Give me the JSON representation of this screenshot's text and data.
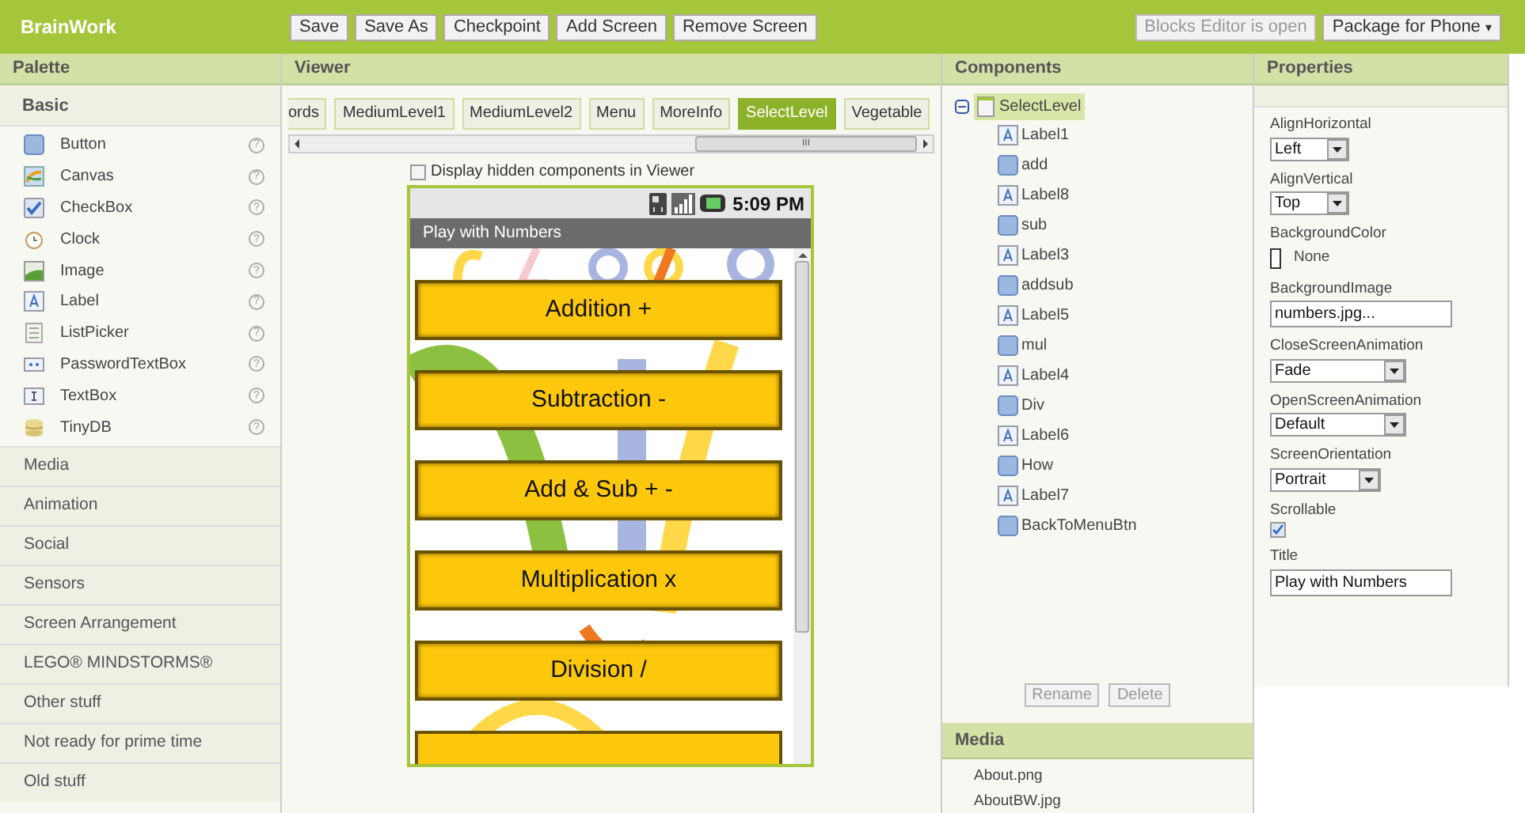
{
  "app": {
    "title": "BrainWork",
    "toolbar": [
      "Save",
      "Save As",
      "Checkpoint",
      "Add Screen",
      "Remove Screen"
    ],
    "blocks_button": {
      "label": "Blocks Editor is open",
      "disabled": true
    },
    "package_button": {
      "label": "Package for Phone",
      "caret": "▾"
    }
  },
  "palette": {
    "title": "Palette",
    "open_group": "Basic",
    "items": [
      {
        "label": "Button",
        "kind": "button",
        "help": "?"
      },
      {
        "label": "Canvas",
        "kind": "canvas",
        "help": "?"
      },
      {
        "label": "CheckBox",
        "kind": "checkbox",
        "help": "?"
      },
      {
        "label": "Clock",
        "kind": "clock",
        "help": "?"
      },
      {
        "label": "Image",
        "kind": "image",
        "help": "?"
      },
      {
        "label": "Label",
        "kind": "label",
        "help": "?"
      },
      {
        "label": "ListPicker",
        "kind": "list",
        "help": "?"
      },
      {
        "label": "PasswordTextBox",
        "kind": "password",
        "help": "?"
      },
      {
        "label": "TextBox",
        "kind": "textbox",
        "help": "?"
      },
      {
        "label": "TinyDB",
        "kind": "db",
        "help": "?"
      }
    ],
    "groups": [
      "Media",
      "Animation",
      "Social",
      "Sensors",
      "Screen Arrangement",
      "LEGO® MINDSTORMS®",
      "Other stuff",
      "Not ready for prime time",
      "Old stuff"
    ]
  },
  "viewer": {
    "title": "Viewer",
    "screens": [
      {
        "label": "ords",
        "selected": false
      },
      {
        "label": "MediumLevel1",
        "selected": false
      },
      {
        "label": "MediumLevel2",
        "selected": false
      },
      {
        "label": "Menu",
        "selected": false
      },
      {
        "label": "MoreInfo",
        "selected": false
      },
      {
        "label": "SelectLevel",
        "selected": true
      },
      {
        "label": "Vegetable",
        "selected": false
      }
    ],
    "scroll_grip": "III",
    "hidden_toggle": {
      "label": "Display hidden components in Viewer",
      "checked": false
    },
    "phone": {
      "time": "5:09 PM",
      "title": "Play with Numbers",
      "buttons": [
        "Addition +",
        "Subtraction -",
        "Add & Sub + -",
        "Multiplication x",
        "Division /"
      ]
    }
  },
  "components": {
    "title": "Components",
    "root": {
      "label": "SelectLevel",
      "expanded": true,
      "selected": true,
      "children": [
        {
          "label": "Label1",
          "kind": "label"
        },
        {
          "label": "add",
          "kind": "button"
        },
        {
          "label": "Label8",
          "kind": "label"
        },
        {
          "label": "sub",
          "kind": "button"
        },
        {
          "label": "Label3",
          "kind": "label"
        },
        {
          "label": "addsub",
          "kind": "button"
        },
        {
          "label": "Label5",
          "kind": "label"
        },
        {
          "label": "mul",
          "kind": "button"
        },
        {
          "label": "Label4",
          "kind": "label"
        },
        {
          "label": "Div",
          "kind": "button"
        },
        {
          "label": "Label6",
          "kind": "label"
        },
        {
          "label": "How",
          "kind": "button"
        },
        {
          "label": "Label7",
          "kind": "label"
        },
        {
          "label": "BackToMenuBtn",
          "kind": "button"
        }
      ]
    },
    "actions": [
      {
        "label": "Rename",
        "disabled": true
      },
      {
        "label": "Delete",
        "disabled": true
      }
    ]
  },
  "media": {
    "title": "Media",
    "files": [
      "About.png",
      "AboutBW.jpg"
    ]
  },
  "properties": {
    "title": "Properties",
    "items": [
      {
        "label": "AlignHorizontal",
        "kind": "select",
        "value": "Left"
      },
      {
        "label": "AlignVertical",
        "kind": "select",
        "value": "Top"
      },
      {
        "label": "BackgroundColor",
        "kind": "color",
        "value": "None"
      },
      {
        "label": "BackgroundImage",
        "kind": "text",
        "value": "numbers.jpg..."
      },
      {
        "label": "CloseScreenAnimation",
        "kind": "select",
        "value": "Fade"
      },
      {
        "label": "OpenScreenAnimation",
        "kind": "select",
        "value": "Default"
      },
      {
        "label": "ScreenOrientation",
        "kind": "select",
        "value": "Portrait"
      },
      {
        "label": "Scrollable",
        "kind": "checkbox",
        "checked": true
      },
      {
        "label": "Title",
        "kind": "text",
        "value": "Play with Numbers"
      }
    ]
  }
}
